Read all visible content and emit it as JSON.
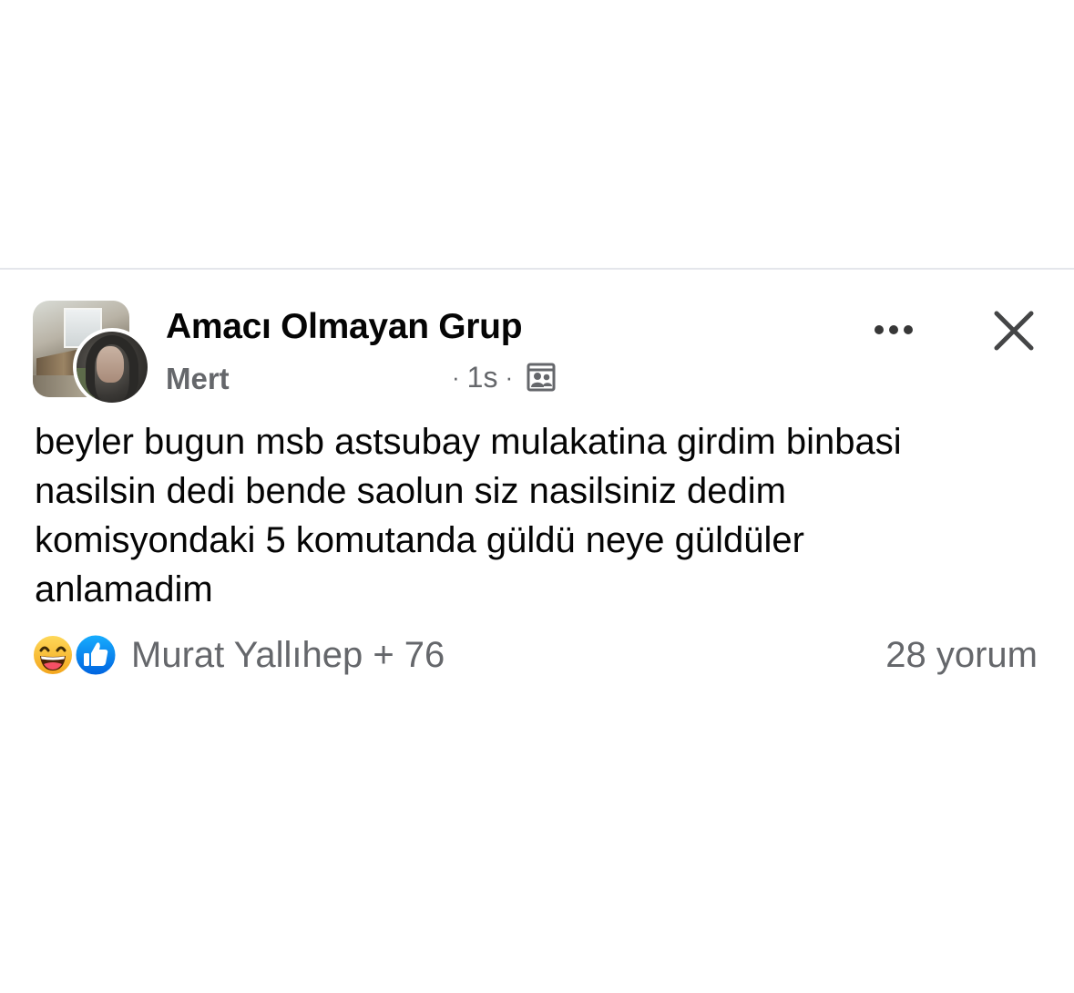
{
  "post": {
    "group_name": "Amacı Olmayan Grup",
    "author_name": "Mert",
    "separator": "·",
    "time": "1s",
    "privacy_icon": "group-members-icon",
    "body_lines": [
      "beyler bugun msb astsubay mulakatina girdim binbasi",
      "nasilsin dedi bende saolun siz nasilsiniz dedim",
      "komisyondaki 5 komutanda güldü neye güldüler",
      "anlamadim"
    ],
    "reactions": {
      "icons": [
        "haha-reaction-icon",
        "like-reaction-icon"
      ],
      "summary": "Murat Yallıhep + 76"
    },
    "comment_count": "28 yorum"
  },
  "colors": {
    "primary_text": "#050505",
    "secondary_text": "#65676b",
    "like_blue": "#1877f2",
    "haha_yellow": "#f7b125",
    "divider": "#e4e6eb"
  }
}
